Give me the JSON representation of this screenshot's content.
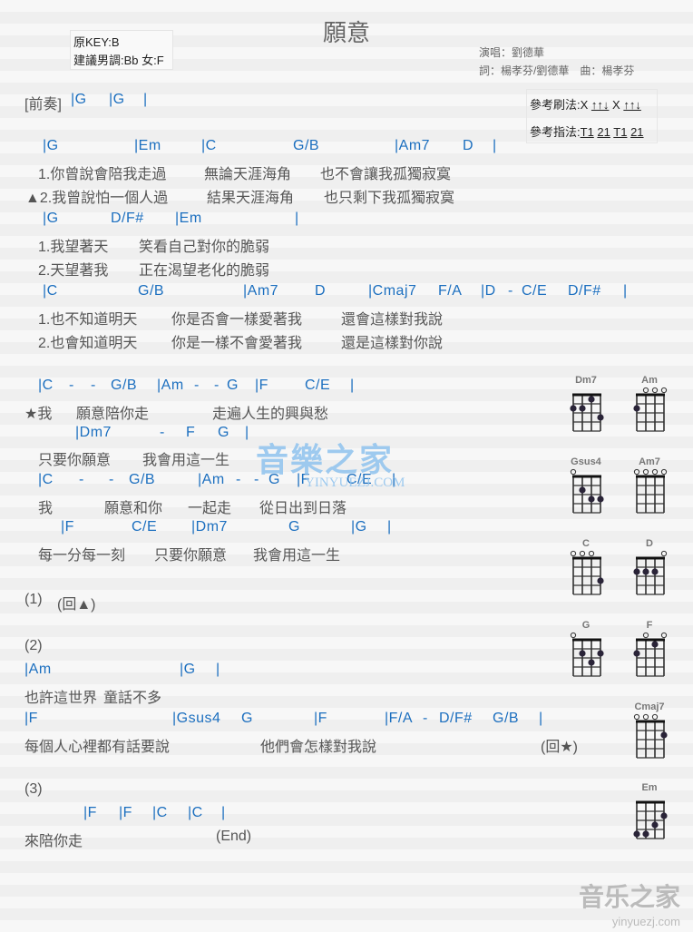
{
  "header": {
    "title": "願意",
    "original_key": "原KEY:B",
    "suggested_key": "建議男調:Bb 女:F",
    "singer": "演唱：劉德華",
    "credits": "詞：楊孝芬/劉德華　曲：楊孝芬",
    "strum_label": "參考刷法:",
    "strum_pattern": [
      "X",
      "↑↑↓",
      "X",
      "↑↑↓"
    ],
    "finger_label": "參考指法:",
    "finger_pattern": [
      "T1",
      "21",
      "T1",
      "21"
    ]
  },
  "sheet": {
    "rows": [
      {
        "type": "lyric",
        "tokens": [
          "[前奏]"
        ]
      },
      {
        "type": "chord",
        "tokens": [
          "|G",
          "|G",
          "|"
        ]
      },
      {
        "type": "chord",
        "tokens": [
          "|G",
          "|Em",
          "|C",
          "G/B",
          "|Am7",
          "D",
          "|"
        ]
      },
      {
        "type": "lyric",
        "tokens": [
          "1.你曾說會陪我走過",
          "無論天涯海角",
          "也不會讓我孤獨寂寞"
        ]
      },
      {
        "type": "lyric",
        "tokens": [
          "▲2.我曾說怕一個人過",
          "結果天涯海角",
          "也只剩下我孤獨寂寞"
        ]
      },
      {
        "type": "chord",
        "tokens": [
          "|G",
          "D/F#",
          "|Em",
          "|"
        ]
      },
      {
        "type": "lyric",
        "tokens": [
          "1.我望著天",
          "笑看自己對你的脆弱"
        ]
      },
      {
        "type": "lyric",
        "tokens": [
          "2.天望著我",
          "正在渴望老化的脆弱"
        ]
      },
      {
        "type": "chord",
        "tokens": [
          "|C",
          "G/B",
          "|Am7",
          "D",
          "|Cmaj7",
          "F/A",
          "|D",
          "-",
          "C/E",
          "D/F#",
          "|"
        ]
      },
      {
        "type": "lyric",
        "tokens": [
          "1.也不知道明天",
          "你是否會一樣愛著我",
          "還會這樣對我說"
        ]
      },
      {
        "type": "lyric",
        "tokens": [
          "2.也會知道明天",
          "你是一樣不會愛著我",
          "還是這樣對你說"
        ]
      },
      {
        "type": "chord",
        "tokens": [
          "|C",
          "-",
          "-",
          "G/B",
          "|Am",
          "-",
          "-",
          "G",
          "|F",
          "C/E",
          "|"
        ]
      },
      {
        "type": "lyric",
        "tokens": [
          "★我",
          "願意陪你走",
          "走遍人生的興與愁"
        ]
      },
      {
        "type": "chord",
        "tokens": [
          "|Dm7",
          "-",
          "F",
          "G",
          "|"
        ]
      },
      {
        "type": "lyric",
        "tokens": [
          "只要你願意",
          "我會用這一生"
        ]
      },
      {
        "type": "chord",
        "tokens": [
          "|C",
          "-",
          "-",
          "G/B",
          "|Am",
          "-",
          "-",
          "G",
          "|F",
          "C/E",
          "|"
        ]
      },
      {
        "type": "lyric",
        "tokens": [
          "我",
          "願意和你",
          "一起走",
          "從日出到日落"
        ]
      },
      {
        "type": "chord",
        "tokens": [
          "|F",
          "C/E",
          "|Dm7",
          "G",
          "|G",
          "|"
        ]
      },
      {
        "type": "lyric",
        "tokens": [
          "每一分每一刻",
          "只要你願意",
          "我會用這一生"
        ]
      },
      {
        "type": "lyric",
        "tokens": [
          "(1)",
          "(回▲)"
        ]
      },
      {
        "type": "lyric",
        "tokens": [
          "(2)"
        ]
      },
      {
        "type": "chord",
        "tokens": [
          "|Am",
          "|G",
          "|"
        ]
      },
      {
        "type": "lyric",
        "tokens": [
          "也許這世界",
          "童話不多"
        ]
      },
      {
        "type": "chord",
        "tokens": [
          "|F",
          "|Gsus4",
          "G",
          "|F",
          "|F/A",
          "-",
          "D/F#",
          "G/B",
          "|"
        ]
      },
      {
        "type": "lyric",
        "tokens": [
          "每個人心裡都有話要說",
          "他們會怎樣對我說",
          "(回★)"
        ]
      },
      {
        "type": "lyric",
        "tokens": [
          "(3)"
        ]
      },
      {
        "type": "chord",
        "tokens": [
          "|F",
          "|F",
          "|C",
          "|C",
          "|"
        ]
      },
      {
        "type": "lyric",
        "tokens": [
          "來陪你走",
          "(End)"
        ]
      }
    ]
  },
  "chord_diagrams": [
    {
      "name": "Dm7",
      "open": [],
      "dots": [
        [
          1,
          2
        ],
        [
          2,
          2
        ],
        [
          3,
          1
        ],
        [
          4,
          3
        ]
      ]
    },
    {
      "name": "Am",
      "open": [
        2,
        3,
        4
      ],
      "dots": [
        [
          1,
          2
        ]
      ]
    },
    {
      "name": "Gsus4",
      "open": [
        1
      ],
      "dots": [
        [
          2,
          2
        ],
        [
          3,
          3
        ],
        [
          4,
          3
        ]
      ]
    },
    {
      "name": "Am7",
      "open": [
        1,
        2,
        3,
        4
      ],
      "dots": []
    },
    {
      "name": "C",
      "open": [
        1,
        2,
        3
      ],
      "dots": [
        [
          4,
          3
        ]
      ]
    },
    {
      "name": "D",
      "open": [
        4
      ],
      "dots": [
        [
          1,
          2
        ],
        [
          2,
          2
        ],
        [
          3,
          2
        ]
      ]
    },
    {
      "name": "G",
      "open": [
        1
      ],
      "dots": [
        [
          2,
          2
        ],
        [
          3,
          3
        ],
        [
          4,
          2
        ]
      ]
    },
    {
      "name": "F",
      "open": [
        2,
        4
      ],
      "dots": [
        [
          1,
          2
        ],
        [
          3,
          1
        ]
      ]
    },
    {
      "name": "Cmaj7",
      "open": [
        1,
        2,
        3
      ],
      "dots": [
        [
          4,
          2
        ]
      ]
    },
    {
      "name": "Em",
      "open": [],
      "dots": [
        [
          1,
          4
        ],
        [
          2,
          4
        ],
        [
          3,
          3
        ],
        [
          4,
          2
        ]
      ]
    }
  ],
  "watermarks": {
    "center_logo": "音樂之家",
    "center_url": "YINYUEZJ.COM",
    "corner_logo": "音乐之家",
    "corner_url": "yinyuezj.com"
  },
  "colors": {
    "chord": "#1c6fbf",
    "bar": "#c08a2a",
    "lyric": "#555555"
  }
}
